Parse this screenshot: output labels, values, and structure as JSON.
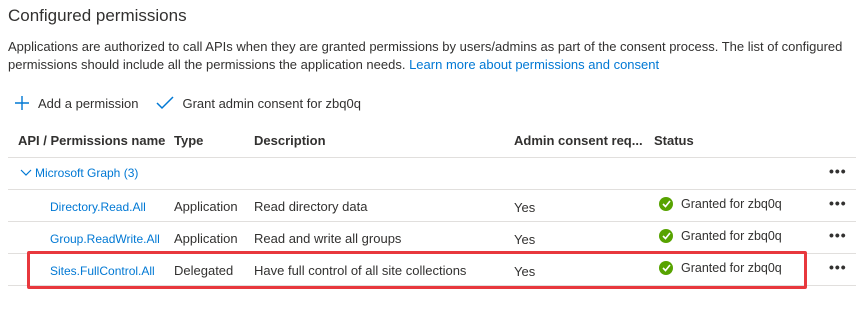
{
  "title": "Configured permissions",
  "description": "Applications are authorized to call APIs when they are granted permissions by users/admins as part of the consent process. The list of configured permissions should include all the permissions the application needs.",
  "learn_more": "Learn more about permissions and consent",
  "toolbar": {
    "add_label": "Add a permission",
    "grant_label": "Grant admin consent for zbq0q"
  },
  "columns": {
    "name": "API / Permissions name",
    "type": "Type",
    "description": "Description",
    "admin": "Admin consent req...",
    "status": "Status"
  },
  "group": {
    "label": "Microsoft Graph (3)"
  },
  "rows": [
    {
      "name": "Directory.Read.All",
      "type": "Application",
      "description": "Read directory data",
      "admin": "Yes",
      "status": "Granted for zbq0q"
    },
    {
      "name": "Group.ReadWrite.All",
      "type": "Application",
      "description": "Read and write all groups",
      "admin": "Yes",
      "status": "Granted for zbq0q"
    },
    {
      "name": "Sites.FullControl.All",
      "type": "Delegated",
      "description": "Have full control of all site collections",
      "admin": "Yes",
      "status": "Granted for zbq0q"
    }
  ],
  "more_glyph": "•••",
  "colors": {
    "accent": "#0078d4",
    "success": "#57a300",
    "highlight": "#e8383d"
  }
}
